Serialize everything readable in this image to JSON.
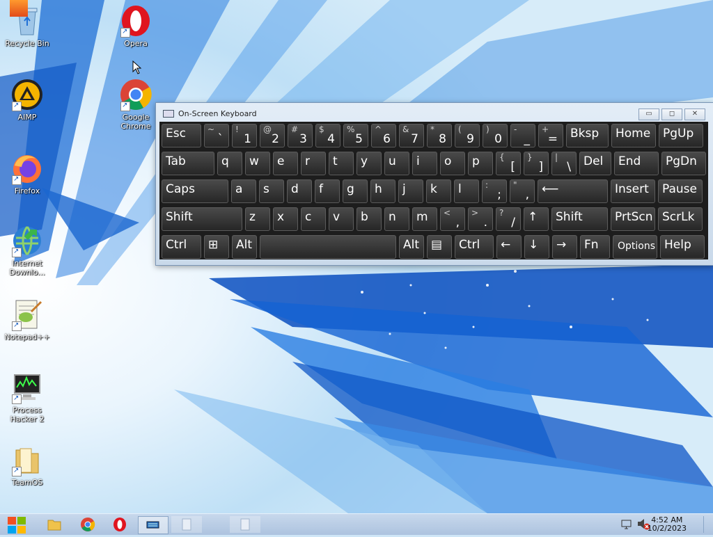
{
  "desktop": {
    "icons": [
      {
        "label": "Recycle Bin"
      },
      {
        "label": "Opera"
      },
      {
        "label": "AIMP"
      },
      {
        "label": "Google Chrome"
      },
      {
        "label": "Firefox"
      },
      {
        "label": "Internet Downlo..."
      },
      {
        "label": "Notepad++"
      },
      {
        "label": "Process Hacker 2"
      },
      {
        "label": "TeamOS"
      }
    ]
  },
  "osk": {
    "title": "On-Screen Keyboard",
    "controls": {
      "minimize": "▭",
      "maximize": "◻",
      "close": "✕"
    },
    "row1": [
      {
        "main": "Esc"
      },
      {
        "shf": "~",
        "low": "`"
      },
      {
        "shf": "!",
        "low": "1"
      },
      {
        "shf": "@",
        "low": "2"
      },
      {
        "shf": "#",
        "low": "3"
      },
      {
        "shf": "$",
        "low": "4"
      },
      {
        "shf": "%",
        "low": "5"
      },
      {
        "shf": "^",
        "low": "6"
      },
      {
        "shf": "&",
        "low": "7"
      },
      {
        "shf": "*",
        "low": "8"
      },
      {
        "shf": "(",
        "low": "9"
      },
      {
        "shf": ")",
        "low": "0"
      },
      {
        "shf": "-",
        "low": "_"
      },
      {
        "shf": "+",
        "low": "="
      },
      {
        "main": "Bksp"
      },
      {
        "main": "Home"
      },
      {
        "main": "PgUp"
      }
    ],
    "row2": [
      {
        "main": "Tab"
      },
      {
        "main": "q"
      },
      {
        "main": "w"
      },
      {
        "main": "e"
      },
      {
        "main": "r"
      },
      {
        "main": "t"
      },
      {
        "main": "y"
      },
      {
        "main": "u"
      },
      {
        "main": "i"
      },
      {
        "main": "o"
      },
      {
        "main": "p"
      },
      {
        "shf": "{",
        "low": "["
      },
      {
        "shf": "}",
        "low": "]"
      },
      {
        "shf": "|",
        "low": "\\"
      },
      {
        "main": "Del"
      },
      {
        "main": "End"
      },
      {
        "main": "PgDn"
      }
    ],
    "row3": [
      {
        "main": "Caps"
      },
      {
        "main": "a"
      },
      {
        "main": "s"
      },
      {
        "main": "d"
      },
      {
        "main": "f"
      },
      {
        "main": "g"
      },
      {
        "main": "h"
      },
      {
        "main": "j"
      },
      {
        "main": "k"
      },
      {
        "main": "l"
      },
      {
        "shf": ":",
        "low": ";"
      },
      {
        "shf": "\"",
        "low": ","
      },
      {
        "main": "⟵"
      },
      {
        "main": "Insert"
      },
      {
        "main": "Pause"
      }
    ],
    "row4": [
      {
        "main": "Shift"
      },
      {
        "main": "z"
      },
      {
        "main": "x"
      },
      {
        "main": "c"
      },
      {
        "main": "v"
      },
      {
        "main": "b"
      },
      {
        "main": "n"
      },
      {
        "main": "m"
      },
      {
        "shf": "<",
        "low": ","
      },
      {
        "shf": ">",
        "low": "."
      },
      {
        "shf": "?",
        "low": "/"
      },
      {
        "main": "↑"
      },
      {
        "main": "Shift"
      },
      {
        "main": "PrtScn"
      },
      {
        "main": "ScrLk"
      }
    ],
    "row5": [
      {
        "main": "Ctrl"
      },
      {
        "main": "⊞"
      },
      {
        "main": "Alt"
      },
      {
        "main": ""
      },
      {
        "main": "Alt"
      },
      {
        "main": "▤"
      },
      {
        "main": "Ctrl"
      },
      {
        "main": "←"
      },
      {
        "main": "↓"
      },
      {
        "main": "→"
      },
      {
        "main": "Fn"
      },
      {
        "main": "Options"
      },
      {
        "main": "Help"
      }
    ]
  },
  "taskbar": {
    "clock_time": "4:52 AM",
    "clock_date": "10/2/2023"
  },
  "colors": {
    "accent": "#1e6fd9",
    "key_bg": "#2e2e2e",
    "taskbar": "#b6cbe5"
  }
}
